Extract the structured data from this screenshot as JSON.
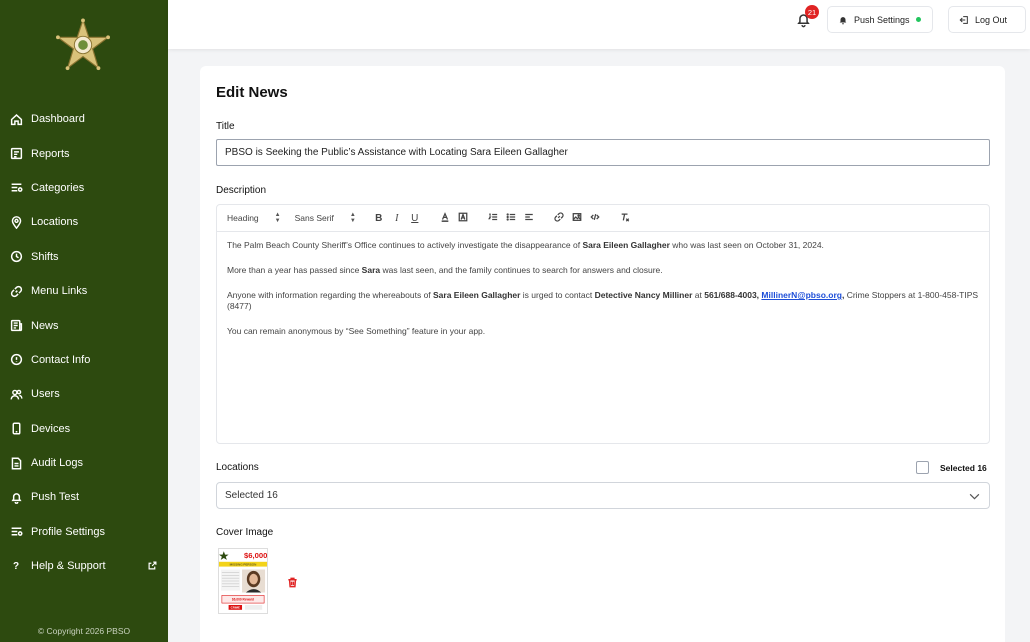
{
  "sidebar": {
    "items": [
      {
        "label": "Dashboard",
        "icon": "home-icon"
      },
      {
        "label": "Reports",
        "icon": "reports-icon"
      },
      {
        "label": "Categories",
        "icon": "categories-icon"
      },
      {
        "label": "Locations",
        "icon": "map-pin-icon"
      },
      {
        "label": "Shifts",
        "icon": "clock-icon"
      },
      {
        "label": "Menu Links",
        "icon": "link-icon"
      },
      {
        "label": "News",
        "icon": "newspaper-icon"
      },
      {
        "label": "Contact Info",
        "icon": "info-icon"
      },
      {
        "label": "Users",
        "icon": "users-icon"
      },
      {
        "label": "Devices",
        "icon": "device-icon"
      },
      {
        "label": "Audit Logs",
        "icon": "document-icon"
      },
      {
        "label": "Push Test",
        "icon": "bell-icon"
      },
      {
        "label": "Profile Settings",
        "icon": "sliders-icon"
      },
      {
        "label": "Help & Support",
        "icon": "question-icon"
      }
    ],
    "copyright": "© Copyright 2026 PBSO"
  },
  "header": {
    "notification_count": "21",
    "push_settings_label": "Push Settings",
    "logout_label": "Log Out"
  },
  "form": {
    "page_title": "Edit News",
    "title_label": "Title",
    "title_value": "PBSO is Seeking the Public’s Assistance with Locating Sara Eileen Gallagher",
    "description_label": "Description",
    "toolbar": {
      "heading": "Heading",
      "font": "Sans Serif"
    },
    "description": {
      "p1_a": "The Palm Beach County Sheriff’s Office continues to actively investigate the disappearance of ",
      "p1_b": "Sara Eileen Gallagher",
      "p1_c": " who was last seen on October 31, 2024.",
      "p2_a": "More than a year has passed since ",
      "p2_b": "Sara",
      "p2_c": " was last seen, and the family continues to search for answers and closure.",
      "p3_a": "Anyone with information regarding the whereabouts of ",
      "p3_b": "Sara Eileen Gallagher",
      "p3_c": " is urged to contact ",
      "p3_d": "Detective Nancy Milliner",
      "p3_e": " at ",
      "p3_f": "561/688-4003,",
      "p3_g": "MillinerN@pbso.org",
      "p3_h": ",",
      "p3_i": " Crime Stoppers at 1-800-458-TIPS (8477)",
      "p4": "You can remain anonymous by “See Something” feature in your app."
    },
    "locations_label": "Locations",
    "selected_count_label": "Selected 16",
    "locations_value": "Selected 16",
    "cover_label": "Cover Image",
    "cover_poster": {
      "reward": "$6,000",
      "headline": "MISSING PERSON",
      "reward_footer": "$6,000 Reward",
      "footer_logo": "CRIME"
    }
  },
  "colors": {
    "sidebar_bg": "#2d4a0f",
    "badge": "#e02424",
    "status_dot": "#22c55e",
    "link": "#1d4ed8",
    "delete": "#e02424"
  }
}
